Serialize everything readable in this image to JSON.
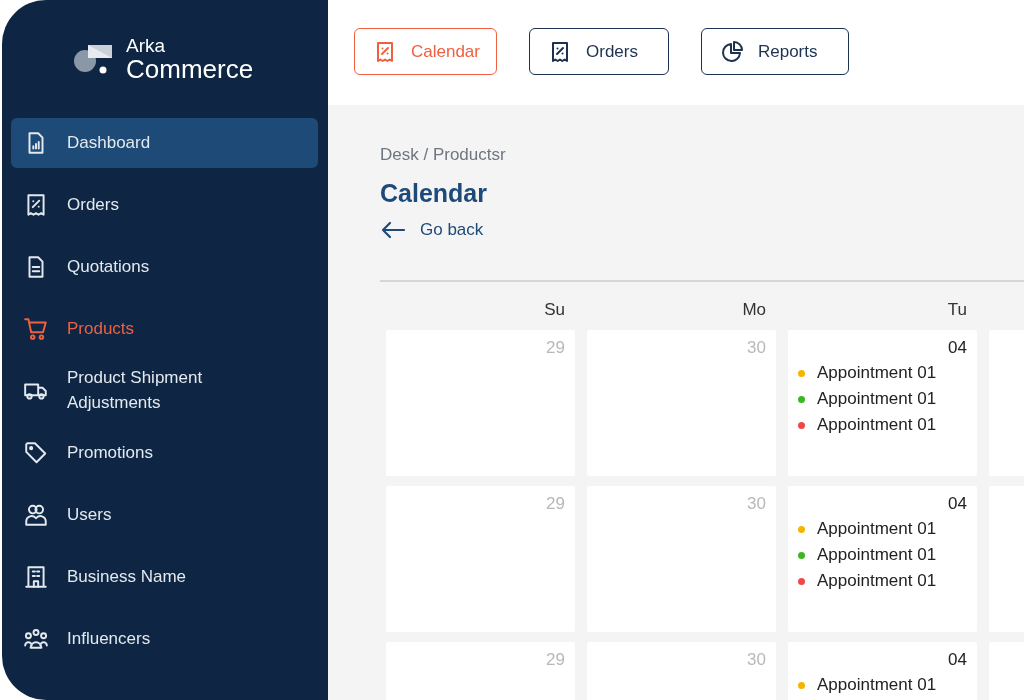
{
  "brand": {
    "line_1": "Arka",
    "line_2": "Commerce"
  },
  "sidebar": {
    "items": [
      {
        "label": "Dashboard",
        "selected": true,
        "highlighted": false
      },
      {
        "label": "Orders",
        "selected": false,
        "highlighted": false
      },
      {
        "label": "Quotations",
        "selected": false,
        "highlighted": false
      },
      {
        "label": "Products",
        "selected": false,
        "highlighted": true
      },
      {
        "label": "Product Shipment Adjustments",
        "selected": false,
        "highlighted": false
      },
      {
        "label": "Promotions",
        "selected": false,
        "highlighted": false
      },
      {
        "label": "Users",
        "selected": false,
        "highlighted": false
      },
      {
        "label": "Business Name",
        "selected": false,
        "highlighted": false
      },
      {
        "label": "Influencers",
        "selected": false,
        "highlighted": false
      }
    ]
  },
  "tabs": [
    {
      "label": "Calendar",
      "selected": true
    },
    {
      "label": "Orders",
      "selected": false
    },
    {
      "label": "Reports",
      "selected": false
    }
  ],
  "breadcrumb": "Desk / Productsr",
  "title": "Calendar",
  "back_link": "Go back",
  "calendar": {
    "weekdays": [
      "Su",
      "Mo",
      "Tu"
    ],
    "weeks": [
      {
        "days": [
          {
            "day": "29",
            "muted": true
          },
          {
            "day": "30",
            "muted": true
          },
          {
            "day": "04",
            "muted": false,
            "appointments": [
              {
                "label": "Appointment 01",
                "color": "#f5b400"
              },
              {
                "label": "Appointment 01",
                "color": "#3cb81e"
              },
              {
                "label": "Appointment 01",
                "color": "#f04848"
              }
            ]
          }
        ]
      },
      {
        "days": [
          {
            "day": "29",
            "muted": true
          },
          {
            "day": "30",
            "muted": true
          },
          {
            "day": "04",
            "muted": false,
            "appointments": [
              {
                "label": "Appointment 01",
                "color": "#f5b400"
              },
              {
                "label": "Appointment 01",
                "color": "#3cb81e"
              },
              {
                "label": "Appointment 01",
                "color": "#f04848"
              }
            ]
          }
        ]
      },
      {
        "days": [
          {
            "day": "29",
            "muted": true
          },
          {
            "day": "30",
            "muted": true
          },
          {
            "day": "04",
            "muted": false,
            "appointments": [
              {
                "label": "Appointment 01",
                "color": "#f5b400"
              }
            ]
          }
        ]
      }
    ]
  }
}
